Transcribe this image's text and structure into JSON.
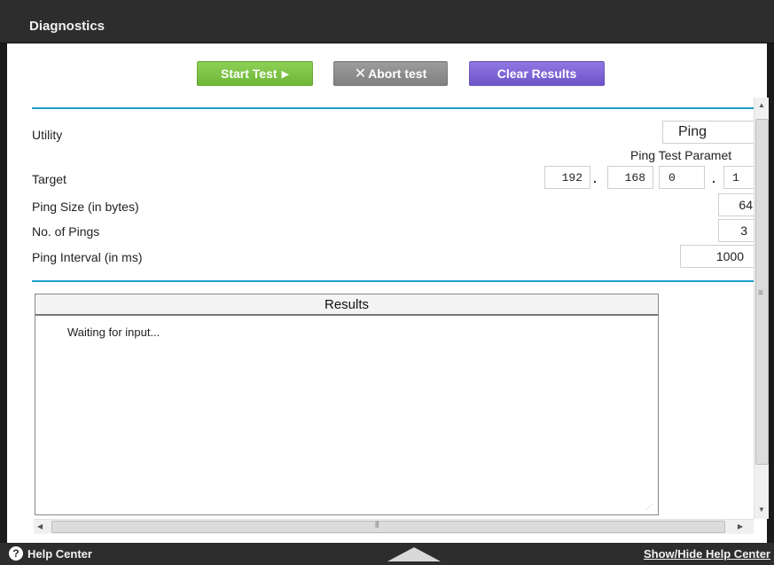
{
  "header": {
    "title": "Diagnostics"
  },
  "toolbar": {
    "start_label": "Start Test",
    "start_icon": "▶",
    "abort_label": "Abort test",
    "abort_icon": "✕",
    "clear_label": "Clear Results"
  },
  "form": {
    "utility_label": "Utility",
    "utility_value": "Ping",
    "params_heading": "Ping Test Paramet",
    "target_label": "Target",
    "target_octets": [
      "192",
      "168",
      "0",
      "1"
    ],
    "dot": ".",
    "ping_size_label": "Ping Size (in bytes)",
    "ping_size_value": "64",
    "num_pings_label": "No. of Pings",
    "num_pings_value": "3",
    "interval_label": "Ping Interval (in ms)",
    "interval_value": "1000"
  },
  "results": {
    "header": "Results",
    "text": "Waiting for input..."
  },
  "footer": {
    "help_center": "Help Center",
    "show_hide": "Show/Hide Help Center"
  },
  "colors": {
    "accent_rule": "#1aa0cc",
    "start_button": "#7bc144",
    "abort_button": "#8c8c8c",
    "clear_button": "#7b63d4",
    "bar": "#2d2d2d"
  },
  "icons": [
    "help-icon",
    "play-icon",
    "close-icon",
    "resize-grip-icon"
  ]
}
